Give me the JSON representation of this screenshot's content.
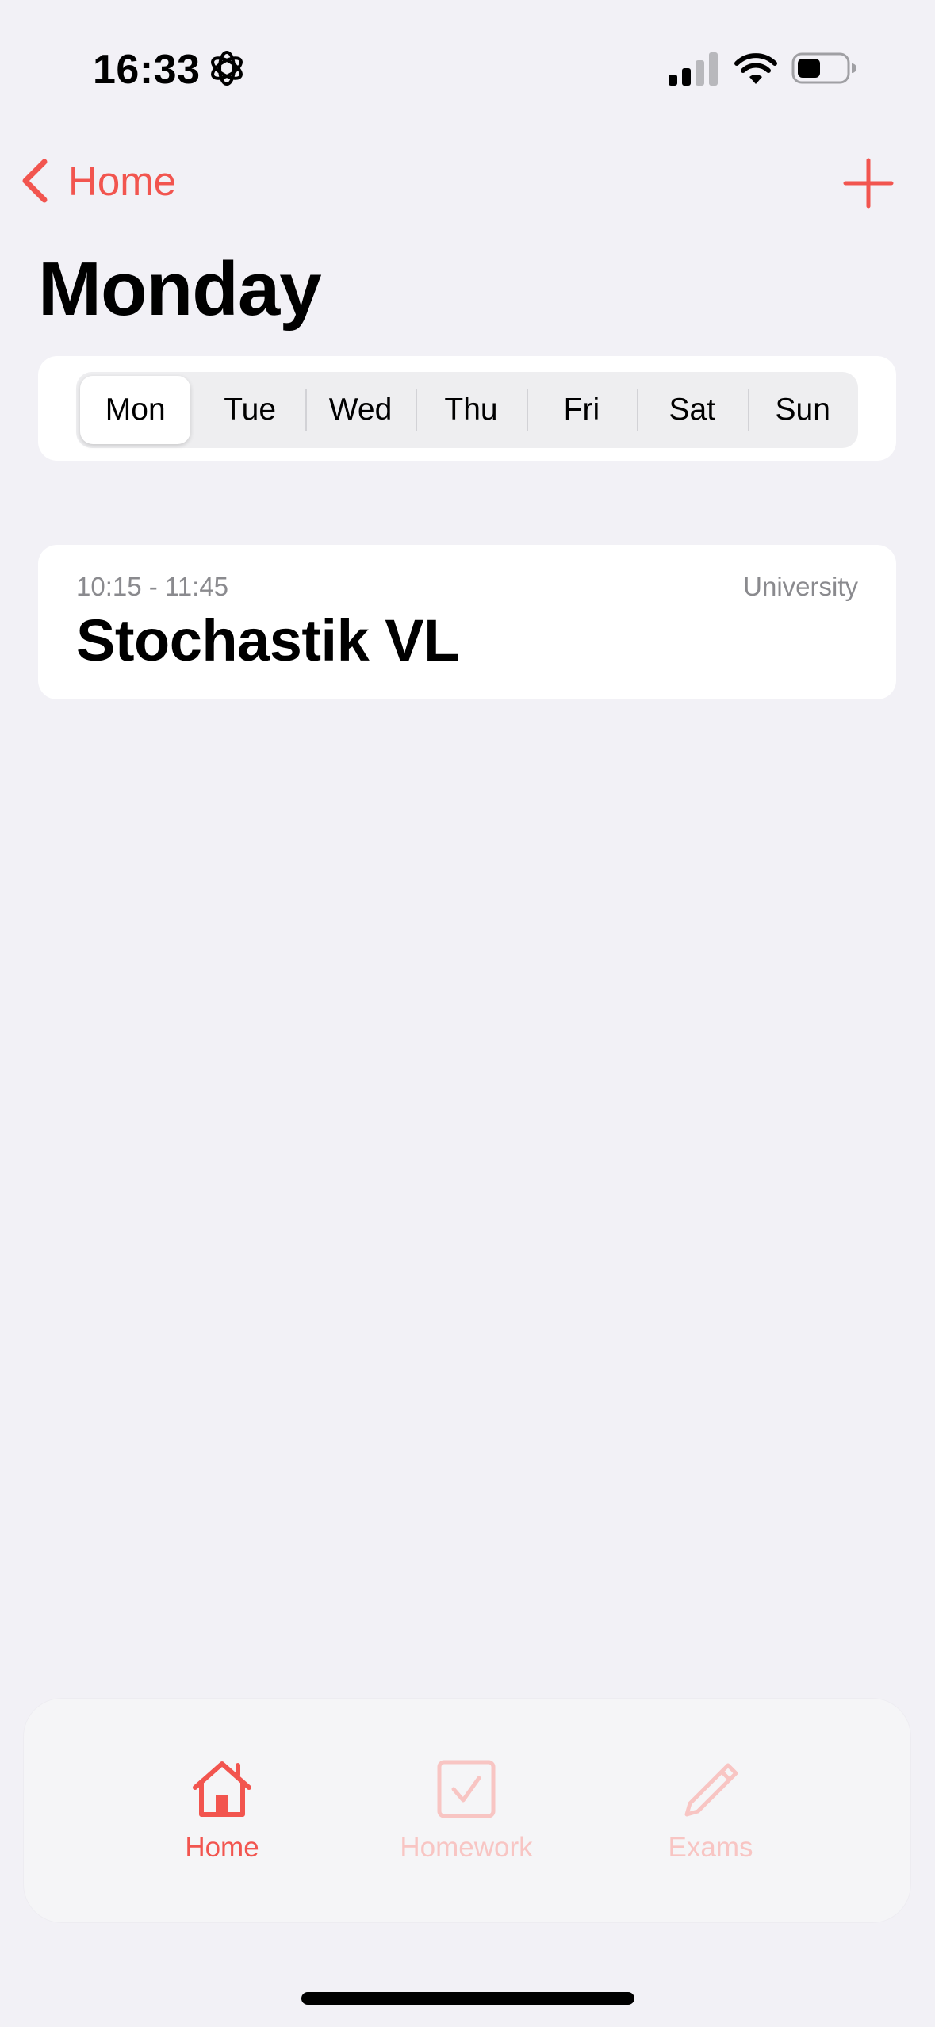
{
  "status_bar": {
    "time": "16:33",
    "icons": [
      "focus-icon",
      "cellular-signal-icon",
      "wifi-icon",
      "battery-icon"
    ]
  },
  "nav": {
    "back_label": "Home",
    "back_icon": "chevron-left-icon",
    "add_icon": "plus-icon"
  },
  "page": {
    "title": "Monday"
  },
  "day_picker": {
    "selected": "Mon",
    "days": [
      "Mon",
      "Tue",
      "Wed",
      "Thu",
      "Fri",
      "Sat",
      "Sun"
    ]
  },
  "events": [
    {
      "time": "10:15 - 11:45",
      "category": "University",
      "title": "Stochastik VL"
    }
  ],
  "tab_bar": {
    "active": "Home",
    "tabs": [
      {
        "label": "Home",
        "icon": "house-icon"
      },
      {
        "label": "Homework",
        "icon": "checkbox-icon"
      },
      {
        "label": "Exams",
        "icon": "pencil-icon"
      }
    ]
  },
  "colors": {
    "accent": "#f2554f",
    "accent_faded": "#f8c5c3",
    "background": "#f2f1f6",
    "card": "#ffffff",
    "secondary_text": "#8a8a8e"
  }
}
